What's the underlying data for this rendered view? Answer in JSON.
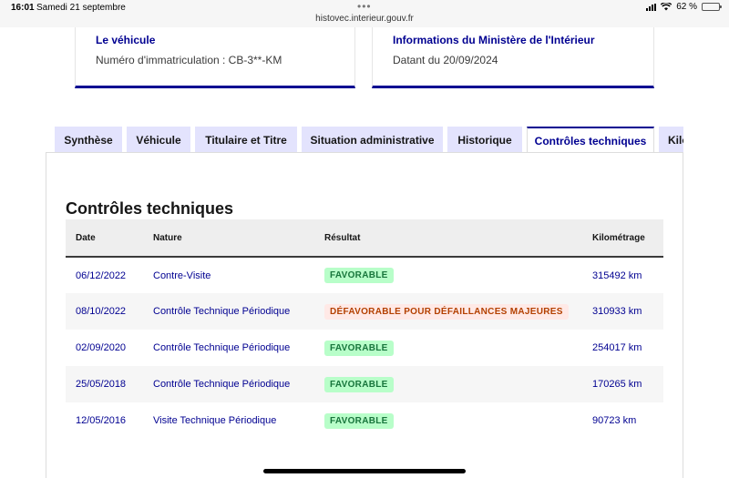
{
  "status_bar": {
    "time": "16:01",
    "date": "Samedi 21 septembre",
    "dots": "•••",
    "url": "histovec.interieur.gouv.fr",
    "battery_percent": "62 %",
    "battery_level": 0.62
  },
  "cards": {
    "vehicle": {
      "title": "Le véhicule",
      "text": "Numéro d'immatriculation : CB-3**-KM"
    },
    "ministry": {
      "title": "Informations du Ministère de l'Intérieur",
      "text": "Datant du 20/09/2024"
    }
  },
  "tabs": [
    {
      "label": "Synthèse",
      "active": false
    },
    {
      "label": "Véhicule",
      "active": false
    },
    {
      "label": "Titulaire et Titre",
      "active": false
    },
    {
      "label": "Situation administrative",
      "active": false
    },
    {
      "label": "Historique",
      "active": false
    },
    {
      "label": "Contrôles techniques",
      "active": true
    },
    {
      "label": "Kilo",
      "active": false
    }
  ],
  "section": {
    "title": "Contrôles techniques"
  },
  "table": {
    "headers": {
      "date": "Date",
      "nature": "Nature",
      "result": "Résultat",
      "mileage": "Kilométrage"
    },
    "rows": [
      {
        "date": "06/12/2022",
        "nature": "Contre-Visite",
        "result": "FAVORABLE",
        "status": "ok",
        "mileage": "315492 km"
      },
      {
        "date": "08/10/2022",
        "nature": "Contrôle Technique Périodique",
        "result": "DÉFAVORABLE POUR DÉFAILLANCES MAJEURES",
        "status": "ko",
        "mileage": "310933 km"
      },
      {
        "date": "02/09/2020",
        "nature": "Contrôle Technique Périodique",
        "result": "FAVORABLE",
        "status": "ok",
        "mileage": "254017 km"
      },
      {
        "date": "25/05/2018",
        "nature": "Contrôle Technique Périodique",
        "result": "FAVORABLE",
        "status": "ok",
        "mileage": "170265 km"
      },
      {
        "date": "12/05/2016",
        "nature": "Visite Technique Périodique",
        "result": "FAVORABLE",
        "status": "ok",
        "mileage": "90723 km"
      }
    ]
  },
  "colors": {
    "accent": "#000091",
    "success_bg": "#b8fec9",
    "success_text": "#18753c",
    "error_bg": "#ffe9e6",
    "error_text": "#b34000"
  }
}
